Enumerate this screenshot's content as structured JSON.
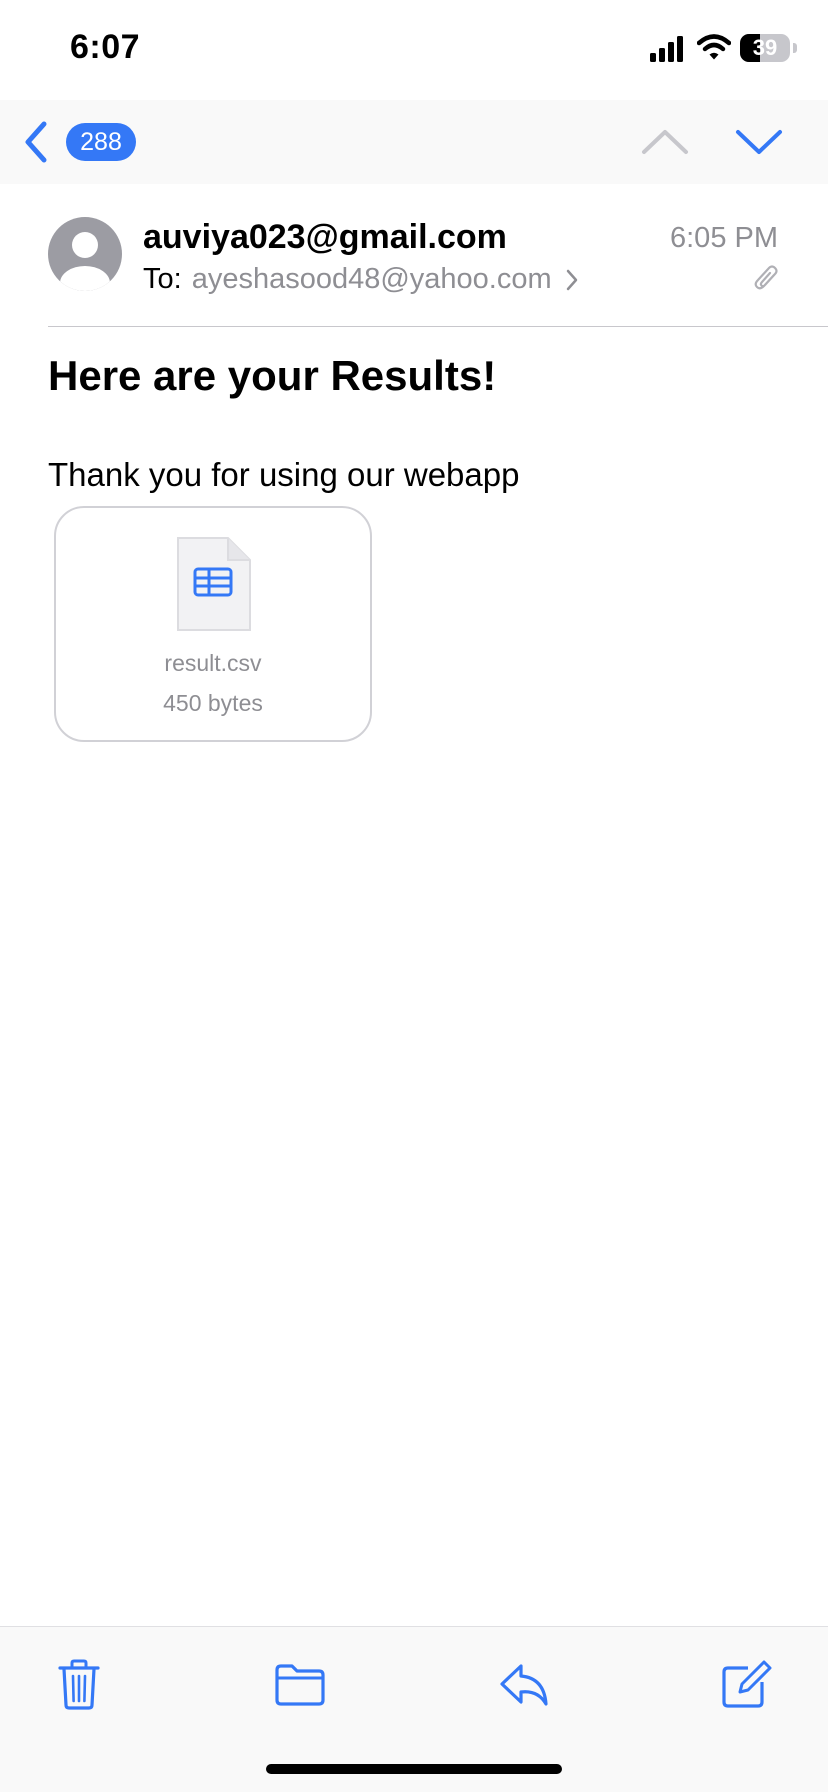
{
  "status_bar": {
    "time": "6:07",
    "battery_level": "39",
    "battery_fraction": 0.39
  },
  "nav": {
    "unread_count": "288",
    "accent_color": "#3478f6",
    "disabled_color": "#c7c7cc"
  },
  "message": {
    "sender": "auviya023@gmail.com",
    "to_label": "To:",
    "to_address": "ayeshasood48@yahoo.com",
    "time": "6:05 PM",
    "subject": "Here are your Results!",
    "body": "Thank you for using our webapp",
    "attachment": {
      "file_name": "result.csv",
      "file_size": "450 bytes",
      "icon": "spreadsheet-file-icon"
    }
  },
  "toolbar": {
    "icons": [
      "trash-icon",
      "folder-icon",
      "reply-icon",
      "compose-icon"
    ]
  }
}
